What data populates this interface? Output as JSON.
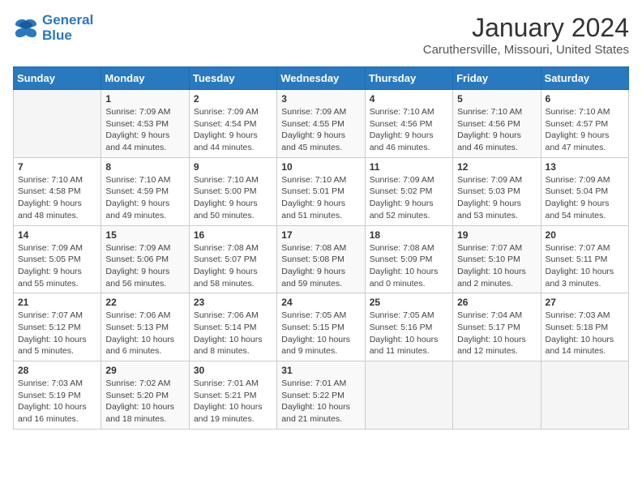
{
  "logo": {
    "line1": "General",
    "line2": "Blue"
  },
  "title": "January 2024",
  "location": "Caruthersville, Missouri, United States",
  "weekdays": [
    "Sunday",
    "Monday",
    "Tuesday",
    "Wednesday",
    "Thursday",
    "Friday",
    "Saturday"
  ],
  "weeks": [
    [
      {
        "day": "",
        "info": ""
      },
      {
        "day": "1",
        "info": "Sunrise: 7:09 AM\nSunset: 4:53 PM\nDaylight: 9 hours\nand 44 minutes."
      },
      {
        "day": "2",
        "info": "Sunrise: 7:09 AM\nSunset: 4:54 PM\nDaylight: 9 hours\nand 44 minutes."
      },
      {
        "day": "3",
        "info": "Sunrise: 7:09 AM\nSunset: 4:55 PM\nDaylight: 9 hours\nand 45 minutes."
      },
      {
        "day": "4",
        "info": "Sunrise: 7:10 AM\nSunset: 4:56 PM\nDaylight: 9 hours\nand 46 minutes."
      },
      {
        "day": "5",
        "info": "Sunrise: 7:10 AM\nSunset: 4:56 PM\nDaylight: 9 hours\nand 46 minutes."
      },
      {
        "day": "6",
        "info": "Sunrise: 7:10 AM\nSunset: 4:57 PM\nDaylight: 9 hours\nand 47 minutes."
      }
    ],
    [
      {
        "day": "7",
        "info": "Sunrise: 7:10 AM\nSunset: 4:58 PM\nDaylight: 9 hours\nand 48 minutes."
      },
      {
        "day": "8",
        "info": "Sunrise: 7:10 AM\nSunset: 4:59 PM\nDaylight: 9 hours\nand 49 minutes."
      },
      {
        "day": "9",
        "info": "Sunrise: 7:10 AM\nSunset: 5:00 PM\nDaylight: 9 hours\nand 50 minutes."
      },
      {
        "day": "10",
        "info": "Sunrise: 7:10 AM\nSunset: 5:01 PM\nDaylight: 9 hours\nand 51 minutes."
      },
      {
        "day": "11",
        "info": "Sunrise: 7:09 AM\nSunset: 5:02 PM\nDaylight: 9 hours\nand 52 minutes."
      },
      {
        "day": "12",
        "info": "Sunrise: 7:09 AM\nSunset: 5:03 PM\nDaylight: 9 hours\nand 53 minutes."
      },
      {
        "day": "13",
        "info": "Sunrise: 7:09 AM\nSunset: 5:04 PM\nDaylight: 9 hours\nand 54 minutes."
      }
    ],
    [
      {
        "day": "14",
        "info": "Sunrise: 7:09 AM\nSunset: 5:05 PM\nDaylight: 9 hours\nand 55 minutes."
      },
      {
        "day": "15",
        "info": "Sunrise: 7:09 AM\nSunset: 5:06 PM\nDaylight: 9 hours\nand 56 minutes."
      },
      {
        "day": "16",
        "info": "Sunrise: 7:08 AM\nSunset: 5:07 PM\nDaylight: 9 hours\nand 58 minutes."
      },
      {
        "day": "17",
        "info": "Sunrise: 7:08 AM\nSunset: 5:08 PM\nDaylight: 9 hours\nand 59 minutes."
      },
      {
        "day": "18",
        "info": "Sunrise: 7:08 AM\nSunset: 5:09 PM\nDaylight: 10 hours\nand 0 minutes."
      },
      {
        "day": "19",
        "info": "Sunrise: 7:07 AM\nSunset: 5:10 PM\nDaylight: 10 hours\nand 2 minutes."
      },
      {
        "day": "20",
        "info": "Sunrise: 7:07 AM\nSunset: 5:11 PM\nDaylight: 10 hours\nand 3 minutes."
      }
    ],
    [
      {
        "day": "21",
        "info": "Sunrise: 7:07 AM\nSunset: 5:12 PM\nDaylight: 10 hours\nand 5 minutes."
      },
      {
        "day": "22",
        "info": "Sunrise: 7:06 AM\nSunset: 5:13 PM\nDaylight: 10 hours\nand 6 minutes."
      },
      {
        "day": "23",
        "info": "Sunrise: 7:06 AM\nSunset: 5:14 PM\nDaylight: 10 hours\nand 8 minutes."
      },
      {
        "day": "24",
        "info": "Sunrise: 7:05 AM\nSunset: 5:15 PM\nDaylight: 10 hours\nand 9 minutes."
      },
      {
        "day": "25",
        "info": "Sunrise: 7:05 AM\nSunset: 5:16 PM\nDaylight: 10 hours\nand 11 minutes."
      },
      {
        "day": "26",
        "info": "Sunrise: 7:04 AM\nSunset: 5:17 PM\nDaylight: 10 hours\nand 12 minutes."
      },
      {
        "day": "27",
        "info": "Sunrise: 7:03 AM\nSunset: 5:18 PM\nDaylight: 10 hours\nand 14 minutes."
      }
    ],
    [
      {
        "day": "28",
        "info": "Sunrise: 7:03 AM\nSunset: 5:19 PM\nDaylight: 10 hours\nand 16 minutes."
      },
      {
        "day": "29",
        "info": "Sunrise: 7:02 AM\nSunset: 5:20 PM\nDaylight: 10 hours\nand 18 minutes."
      },
      {
        "day": "30",
        "info": "Sunrise: 7:01 AM\nSunset: 5:21 PM\nDaylight: 10 hours\nand 19 minutes."
      },
      {
        "day": "31",
        "info": "Sunrise: 7:01 AM\nSunset: 5:22 PM\nDaylight: 10 hours\nand 21 minutes."
      },
      {
        "day": "",
        "info": ""
      },
      {
        "day": "",
        "info": ""
      },
      {
        "day": "",
        "info": ""
      }
    ]
  ]
}
